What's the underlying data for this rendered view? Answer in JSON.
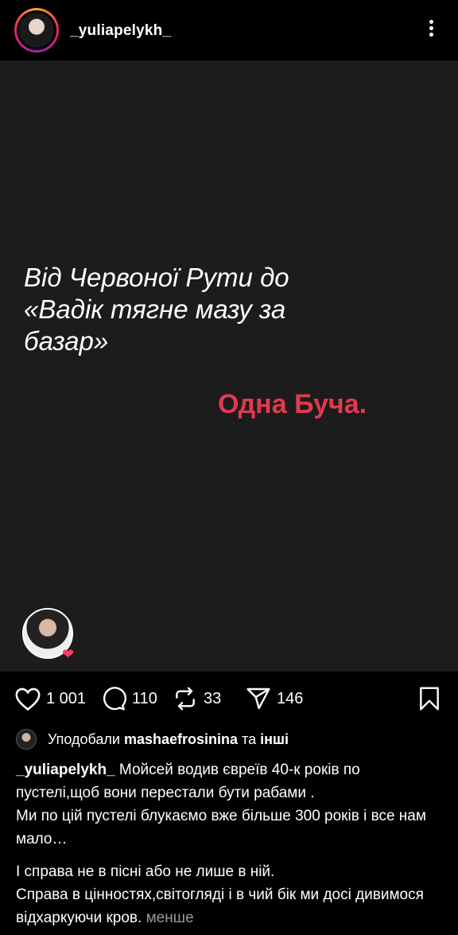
{
  "header": {
    "username": "_yuliapelykh_"
  },
  "post": {
    "quote_line1": "Від Червоної Рути до",
    "quote_line2": "«Вадік тягне мазу за",
    "quote_line3": "базар»",
    "accent": "Одна Буча.",
    "accent_color": "#e03a4e",
    "background": "#1c1c1c",
    "tagged_heart": "❤"
  },
  "actions": {
    "likes": "1 001",
    "comments": "110",
    "reposts": "33",
    "shares": "146"
  },
  "liked_by": {
    "prefix": "Уподобали",
    "user": "mashaefrosinina",
    "middle": "та",
    "others": "інші"
  },
  "caption": {
    "author": "_yuliapelykh_",
    "text1": " Мойсей водив євреїв 40-к років по пустелі,щоб вони перестали бути рабами .",
    "text2": "Ми по цій пустелі блукаємо вже більше 300 років і все нам мало…",
    "text3": "І справа не в пісні або не лише в ній.",
    "text4": "Справа в цінностях,світогляді і в чий бік ми досі дивимося відхаркуючи кров.",
    "less": "менше"
  }
}
